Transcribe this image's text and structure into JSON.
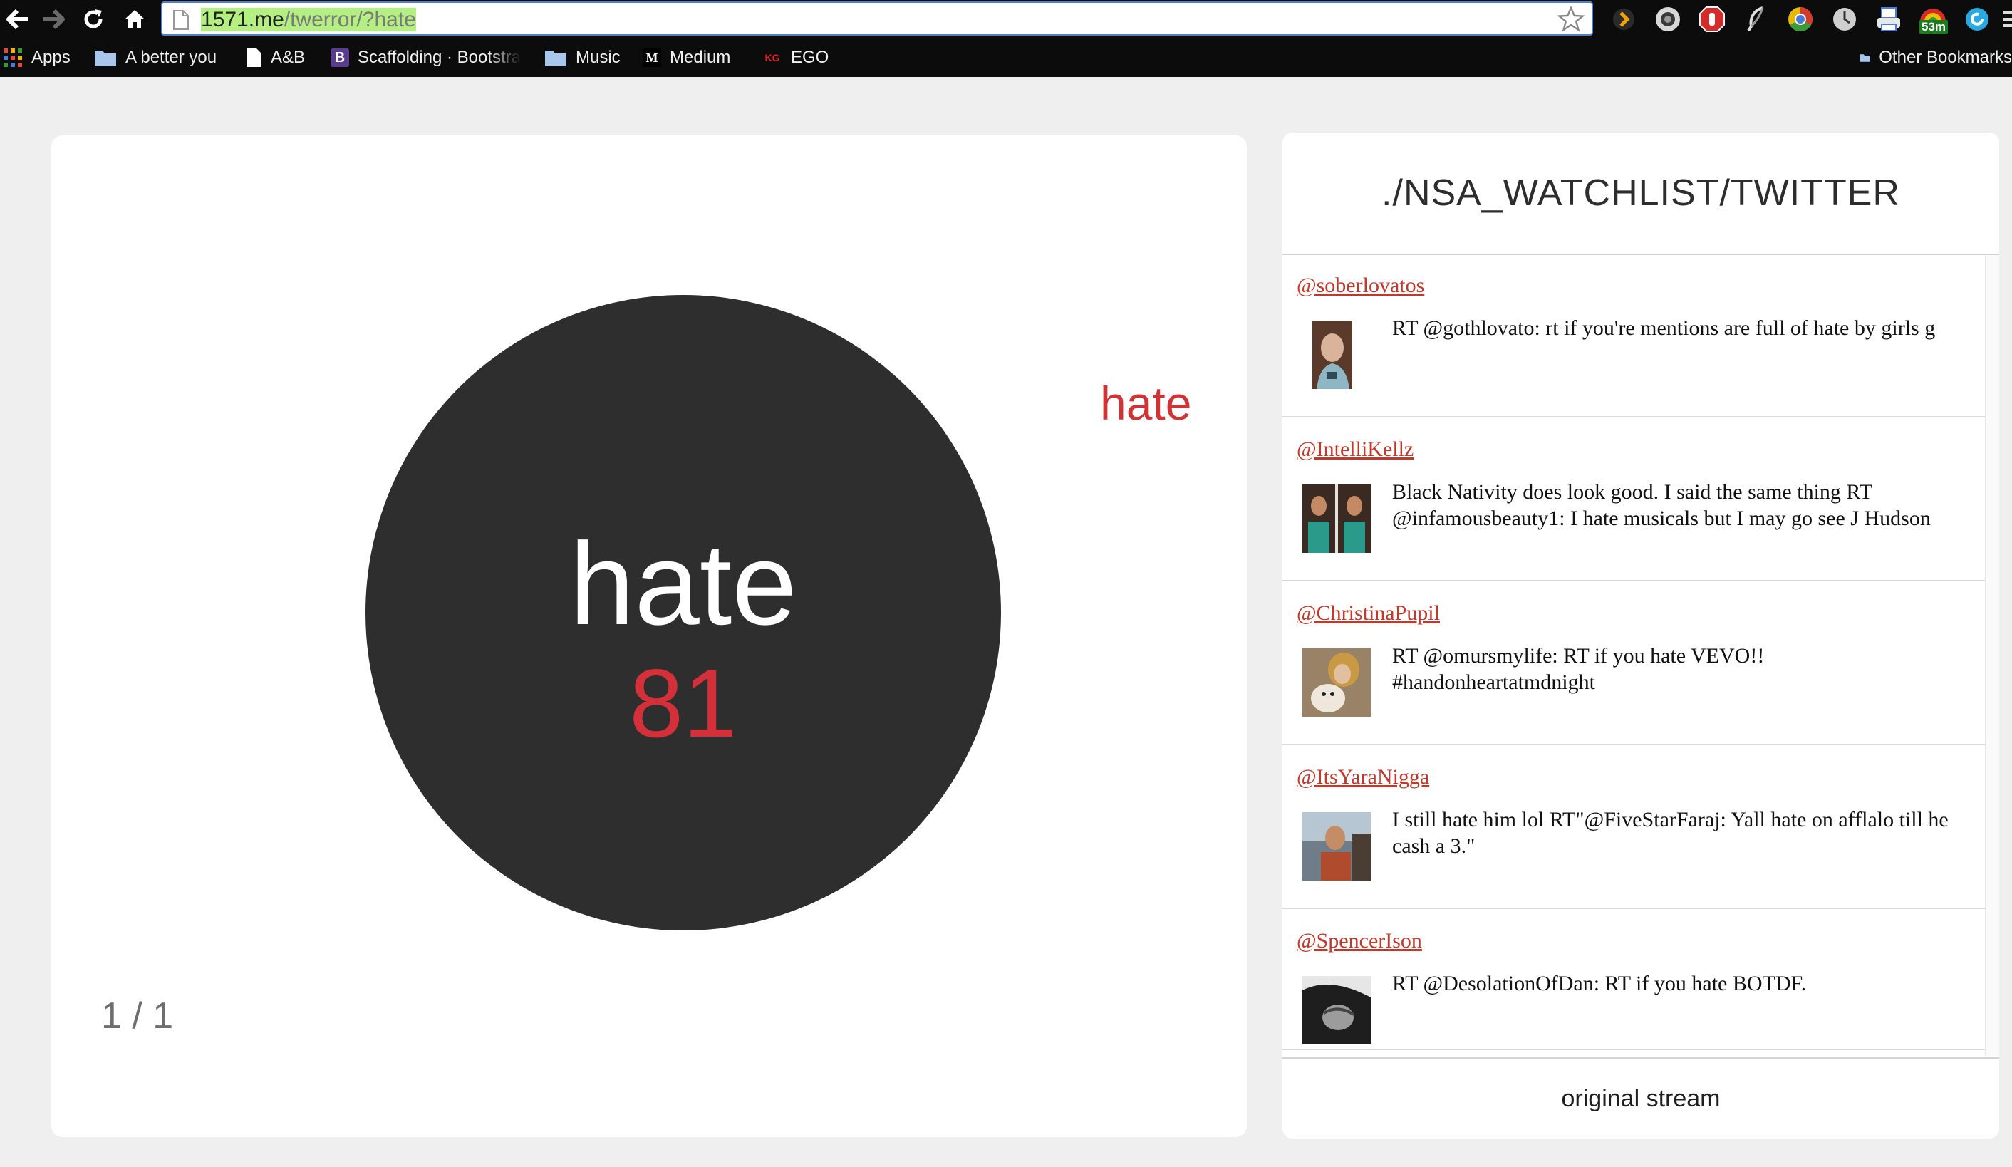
{
  "browser": {
    "url_host": "1571.me",
    "url_path": "/twerror/?hate",
    "extensions": [
      "plex-icon",
      "camera-icon",
      "shield-icon",
      "feather-icon",
      "chrome-canary-icon",
      "clock-icon",
      "printer-icon",
      "timer-icon",
      "refresh-circle-icon"
    ],
    "timer_badge": "53m",
    "bookmarks": [
      {
        "label": "Apps",
        "icon": "apps-grid-icon"
      },
      {
        "label": "A better you",
        "icon": "folder-icon"
      },
      {
        "label": "A&B",
        "icon": "page-icon"
      },
      {
        "label": "Scaffolding · Bootstra",
        "icon": "bootstrap-icon",
        "icon_text": "B"
      },
      {
        "label": "Music",
        "icon": "folder-icon"
      },
      {
        "label": "Medium",
        "icon": "medium-icon",
        "icon_text": "M"
      },
      {
        "label": "EGO",
        "icon": "kg-icon",
        "icon_text": "KG"
      },
      {
        "label": "Other Bookmarks",
        "icon": "folder-icon"
      }
    ]
  },
  "visual": {
    "word": "hate",
    "count": "81",
    "side_word": "hate",
    "pager": "1 / 1",
    "colors": {
      "accent": "#d3303a",
      "circle": "#2e2e2e",
      "background": "#efefef"
    }
  },
  "feed": {
    "title": "./NSA_WATCHLIST/TWITTER",
    "tweets": [
      {
        "user": "@soberlovatos",
        "text": "RT @gothlovato: rt if you're mentions are full of hate by girls g"
      },
      {
        "user": "@IntelliKellz",
        "text": "Black Nativity does look good. I said the same thing RT @infamousbeauty1: I hate musicals but I may go see J Hudson"
      },
      {
        "user": "@ChristinaPupil",
        "text": "RT @omursmylife: RT if you hate VEVO!! #handonheartatmdnight"
      },
      {
        "user": "@ItsYaraNigga",
        "text": "I still hate him lol RT\"@FiveStarFaraj: Yall hate on afflalo till he cash a 3.\""
      },
      {
        "user": "@SpencerIson",
        "text": "RT @DesolationOfDan: RT if you hate BOTDF."
      }
    ],
    "footer_link": "original stream"
  }
}
